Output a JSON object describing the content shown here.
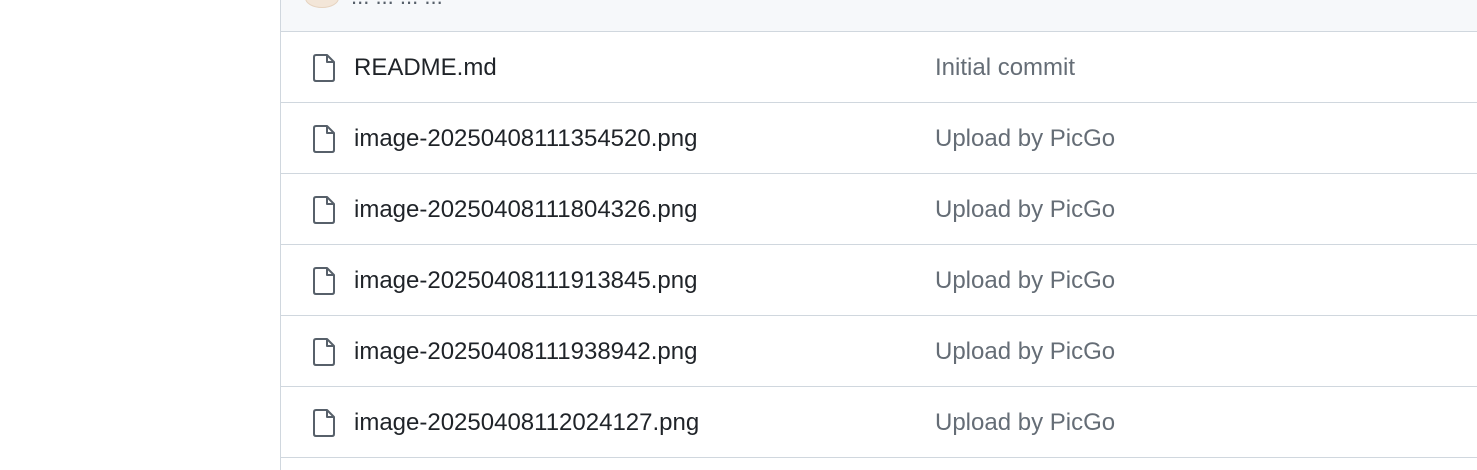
{
  "header": {
    "latest_commit_text": "... ... ... ..."
  },
  "files": [
    {
      "name": "README.md",
      "commit_message": "Initial commit",
      "icon": "file-icon"
    },
    {
      "name": "image-20250408111354520.png",
      "commit_message": "Upload by PicGo",
      "icon": "file-icon"
    },
    {
      "name": "image-20250408111804326.png",
      "commit_message": "Upload by PicGo",
      "icon": "file-icon"
    },
    {
      "name": "image-20250408111913845.png",
      "commit_message": "Upload by PicGo",
      "icon": "file-icon"
    },
    {
      "name": "image-20250408111938942.png",
      "commit_message": "Upload by PicGo",
      "icon": "file-icon"
    },
    {
      "name": "image-20250408112024127.png",
      "commit_message": "Upload by PicGo",
      "icon": "file-icon"
    }
  ],
  "colors": {
    "border": "#d0d7de",
    "header_bg": "#f6f8fa",
    "file_name": "#1f2328",
    "commit_message": "#656d76",
    "icon": "#57606a"
  }
}
